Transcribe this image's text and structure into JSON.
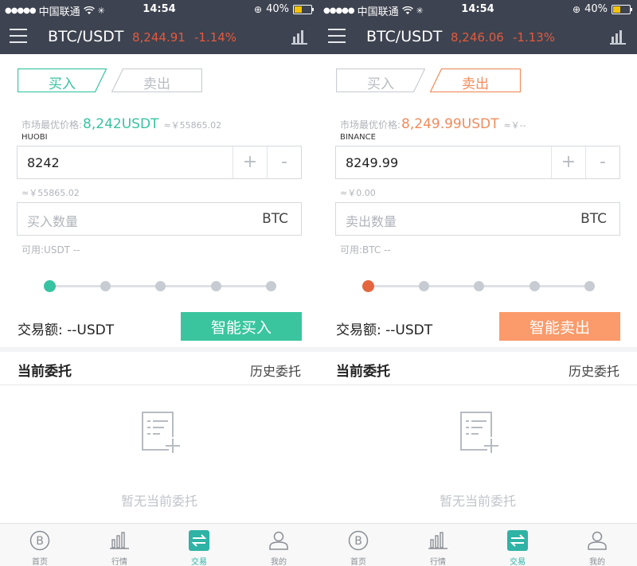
{
  "status_bar": {
    "carrier": "中国联通",
    "time": "14:54",
    "battery": "40%",
    "battery_level": 0.4
  },
  "colors": {
    "header_bg": "#3d4350",
    "header_price": "#e35a3f",
    "buy_accent": "#37c3a1",
    "sell_accent": "#f08b5b",
    "buy_button": "#3ac59e",
    "sell_button": "#fb9a6a",
    "tabbar_active": "#2eb3a5",
    "muted": "#b0b4ba"
  },
  "tabbar": {
    "items": [
      {
        "label": "首页",
        "icon": "bitcoin-home-icon"
      },
      {
        "label": "行情",
        "icon": "bar-chart-icon"
      },
      {
        "label": "交易",
        "icon": "exchange-arrows-icon"
      },
      {
        "label": "我的",
        "icon": "user-profile-icon"
      }
    ],
    "active_index": 2
  },
  "panels": [
    {
      "mode": "buy",
      "header": {
        "pair": "BTC/USDT",
        "price": "8,244.91",
        "change": "-1.14%"
      },
      "tabs": {
        "buy": "买入",
        "sell": "卖出"
      },
      "market": {
        "label": "市场最优价格:",
        "price": "8,242USDT",
        "cny": "≈￥55865.02",
        "exchange": "HUOBI"
      },
      "price_input": {
        "value": "8242",
        "plus": "+",
        "minus": "-"
      },
      "price_cny": "≈￥55865.02",
      "amount_input": {
        "placeholder": "买入数量",
        "unit": "BTC"
      },
      "available": "可用:USDT --",
      "slider": {
        "steps": 5,
        "active_step": 0
      },
      "total": "交易额: --USDT",
      "submit": "智能买入",
      "orders": {
        "title": "当前委托",
        "history": "历史委托",
        "empty": "暂无当前委托"
      }
    },
    {
      "mode": "sell",
      "header": {
        "pair": "BTC/USDT",
        "price": "8,246.06",
        "change": "-1.13%"
      },
      "tabs": {
        "buy": "买入",
        "sell": "卖出"
      },
      "market": {
        "label": "市场最优价格:",
        "price": "8,249.99USDT",
        "cny": "≈￥--",
        "exchange": "BINANCE"
      },
      "price_input": {
        "value": "8249.99",
        "plus": "+",
        "minus": "-"
      },
      "price_cny": "≈￥0.00",
      "amount_input": {
        "placeholder": "卖出数量",
        "unit": "BTC"
      },
      "available": "可用:BTC --",
      "slider": {
        "steps": 5,
        "active_step": 0
      },
      "total": "交易额: --USDT",
      "submit": "智能卖出",
      "orders": {
        "title": "当前委托",
        "history": "历史委托",
        "empty": "暂无当前委托"
      }
    }
  ]
}
